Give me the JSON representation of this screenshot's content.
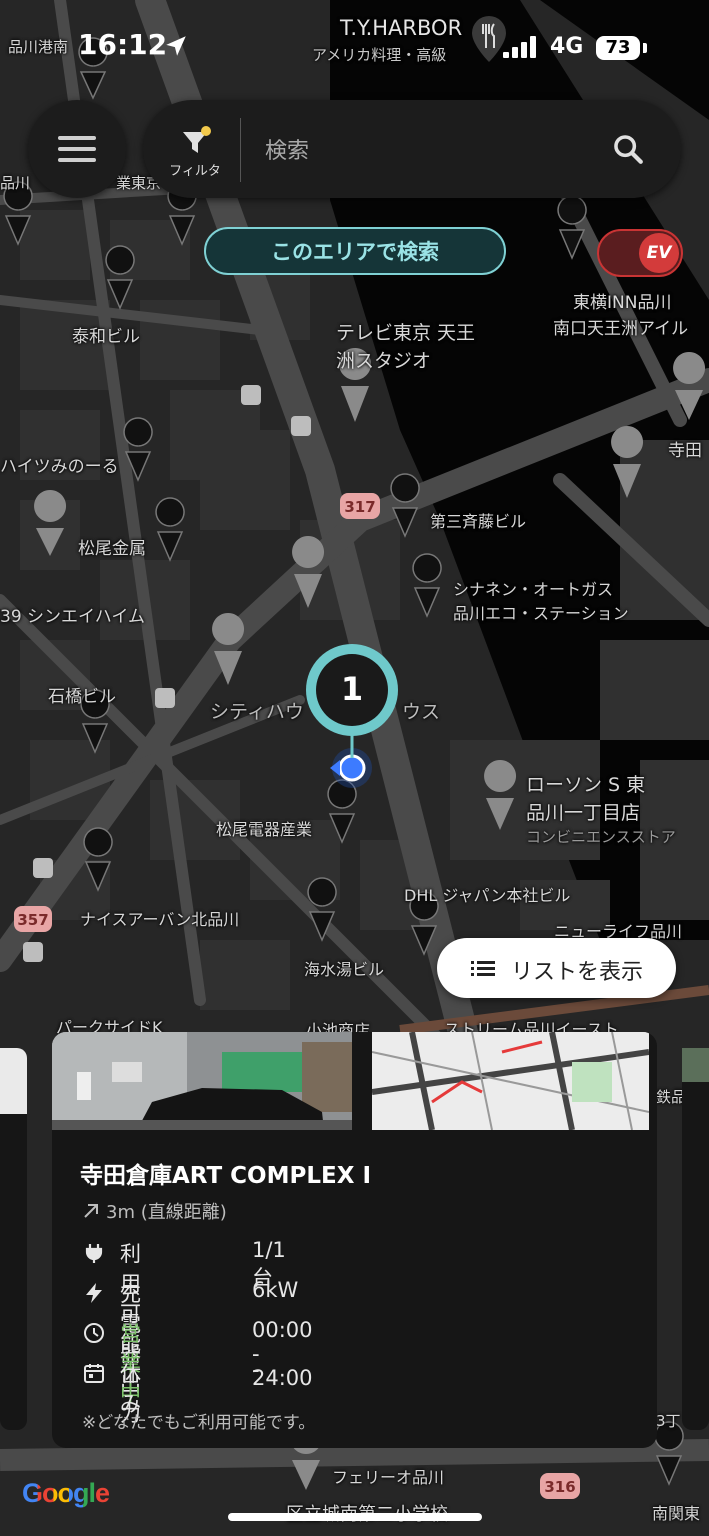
{
  "status_bar": {
    "time": "16:12",
    "network": "4G",
    "battery": "73"
  },
  "search_bar": {
    "filter_label": "フィルタ",
    "placeholder": "検索"
  },
  "area_search_label": "このエリアで検索",
  "ev_toggle_label": "EV",
  "list_button_label": "リストを表示",
  "map": {
    "cluster_count": "1",
    "places": [
      {
        "text": "T.Y.HARBOR",
        "name": "map-label-ty-harbor"
      },
      {
        "text": "アメリカ料理・高級",
        "name": "map-label-ty-harbor-sub"
      },
      {
        "text": "テレビ東京 天王",
        "name": "map-label-tvtokyo-1"
      },
      {
        "text": "洲スタジオ",
        "name": "map-label-tvtokyo-2"
      },
      {
        "text": "東横INN品川",
        "name": "map-label-toyoko-1"
      },
      {
        "text": "南口天王洲アイル",
        "name": "map-label-toyoko-2"
      },
      {
        "text": "泰和ビル",
        "name": "map-label-taiwa"
      },
      {
        "text": "寺田",
        "name": "map-label-terada"
      },
      {
        "text": "ハイツみのーる",
        "name": "map-label-heights"
      },
      {
        "text": "第三斉藤ビル",
        "name": "map-label-saito"
      },
      {
        "text": "松尾金属",
        "name": "map-label-matsuo-kinzoku"
      },
      {
        "text": "シナネン・オートガス",
        "name": "map-label-sinanen-1"
      },
      {
        "text": "品川エコ・ステーション",
        "name": "map-label-sinanen-2"
      },
      {
        "text": "39 シンエイハイム",
        "name": "map-label-shinei"
      },
      {
        "text": "石橋ビル",
        "name": "map-label-ishibashi"
      },
      {
        "text": "シティハウ",
        "name": "map-label-cityhouse-1"
      },
      {
        "text": "ウス",
        "name": "map-label-cityhouse-2"
      },
      {
        "text": "ローソン S 東",
        "name": "map-label-lawson-1"
      },
      {
        "text": "品川一丁目店",
        "name": "map-label-lawson-2"
      },
      {
        "text": "コンビニエンスストア",
        "name": "map-label-lawson-3"
      },
      {
        "text": "松尾電器産業",
        "name": "map-label-matsuo-denki"
      },
      {
        "text": "DHL ジャパン本社ビル",
        "name": "map-label-dhl"
      },
      {
        "text": "ナイスアーバン北品川",
        "name": "map-label-nice-urban"
      },
      {
        "text": "ニューライフ品川",
        "name": "map-label-newlife"
      },
      {
        "text": "海水湯ビル",
        "name": "map-label-kaisuiyu"
      },
      {
        "text": "パークサイドK",
        "name": "map-label-parkside"
      },
      {
        "text": "小池商店",
        "name": "map-label-koike"
      },
      {
        "text": "ストリーム品川イースト",
        "name": "map-label-stream"
      },
      {
        "text": "フェリーオ品川",
        "name": "map-label-ferio"
      },
      {
        "text": "区立城南第二小学校",
        "name": "map-label-school"
      },
      {
        "text": "南関東",
        "name": "map-label-minamikanto"
      },
      {
        "text": "品川港南",
        "name": "map-label-shinagawa-konan"
      },
      {
        "text": "業東京",
        "name": "map-label-gyo-tokyo"
      },
      {
        "text": "品川",
        "name": "map-label-shinagawa-left"
      },
      {
        "text": "鉄品",
        "name": "map-label-tetsu"
      },
      {
        "text": "3丁",
        "name": "map-label-3cho"
      }
    ],
    "road_badges": [
      "317",
      "357",
      "316"
    ],
    "google_logo": "Google"
  },
  "station_card": {
    "title": "寺田倉庫ART COMPLEX Ⅰ",
    "distance": "3m (直線距離)",
    "rows": [
      {
        "key": "利用可能",
        "value": "1/1台",
        "icon": "plug-icon"
      },
      {
        "key": "充電器出力",
        "value": "6kW",
        "icon": "bolt-icon"
      },
      {
        "key": "営業中",
        "value": "00:00 - 24:00",
        "icon": "clock-icon"
      },
      {
        "key": "休み",
        "value": "-",
        "icon": "calendar-icon"
      }
    ],
    "note": "※どなたでもご利用可能です。",
    "open_color": "#7cc36a"
  },
  "colors": {
    "accent_teal": "#7fd1d4",
    "ev_red": "#d33b3b",
    "marker_teal": "#6fc9cb"
  }
}
